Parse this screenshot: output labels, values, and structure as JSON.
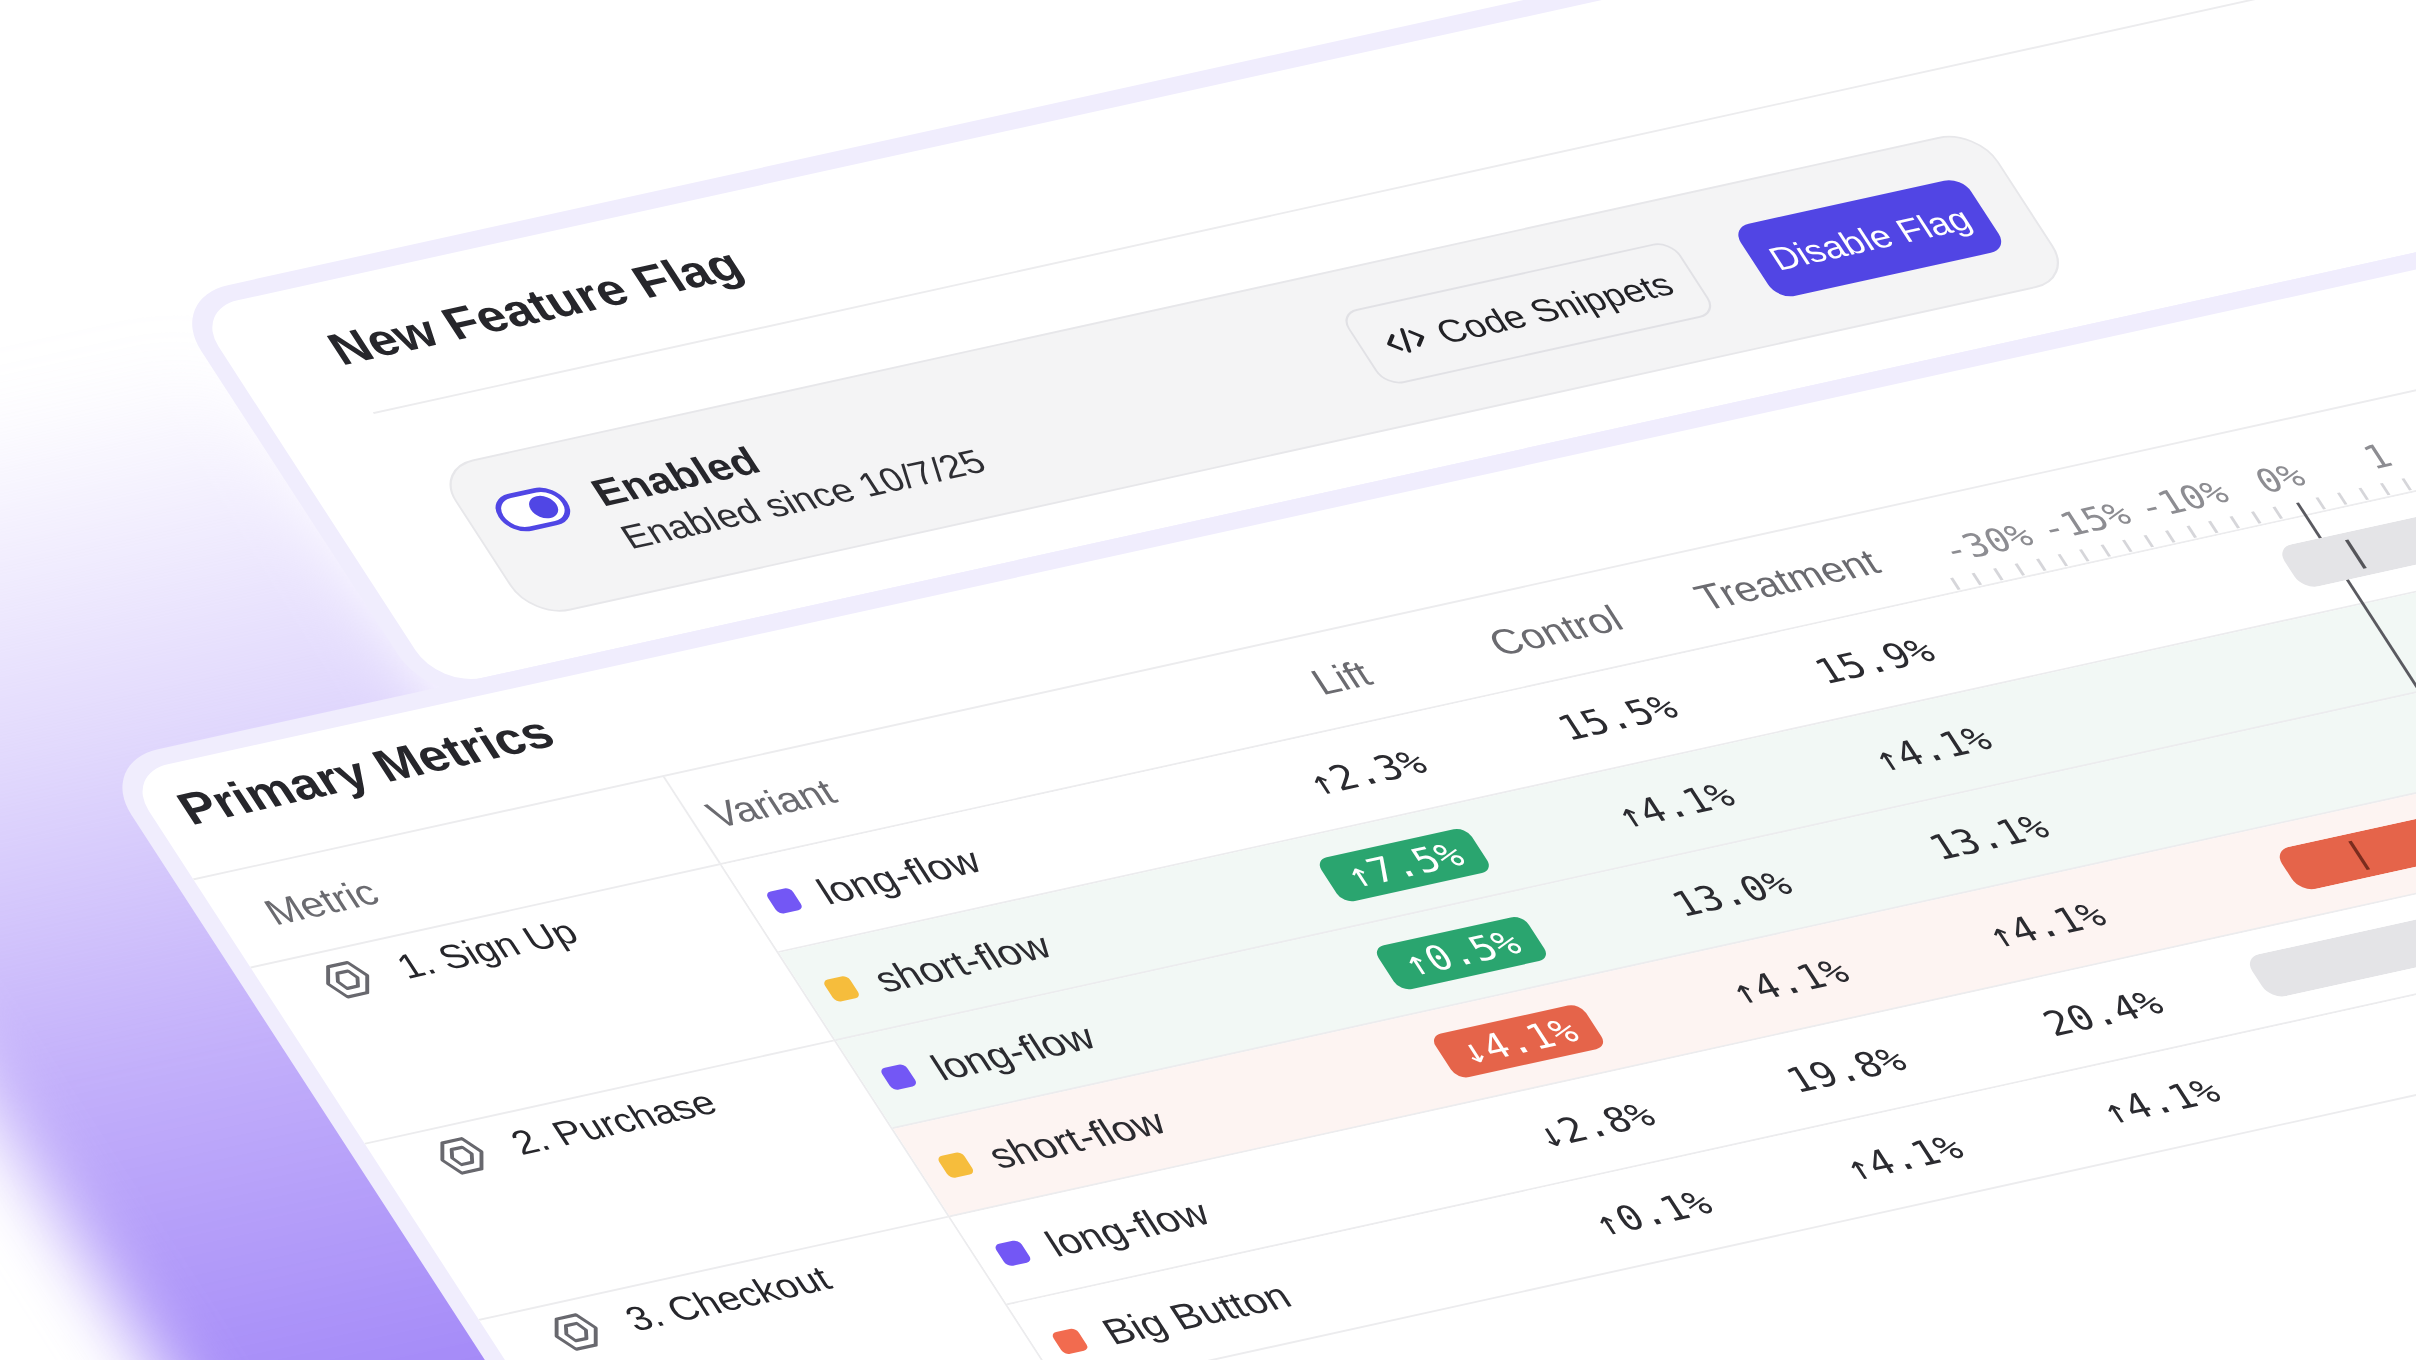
{
  "feature_flag": {
    "title": "New Feature Flag",
    "status": {
      "enabled": true,
      "label": "Enabled",
      "detail": "Enabled since 10/7/25"
    },
    "buttons": [
      {
        "kind": "code",
        "label": "Code Snippets"
      },
      {
        "kind": "primary",
        "label": "Disable Flag"
      }
    ]
  },
  "primary_metrics": {
    "title": "Primary Metrics",
    "columns": [
      "Metric",
      "Variant",
      "Lift",
      "Control",
      "Treatment"
    ],
    "axis_labels": [
      "-30%",
      "-15%",
      "-10%",
      "0%",
      "1"
    ],
    "metrics": [
      {
        "name": "1. Sign Up",
        "variants": [
          {
            "kind": "neutral",
            "name": "long-flow",
            "color": "#7357f5",
            "lift": "↑2.3%",
            "control": "15.5%",
            "treatment": "15.9%"
          },
          {
            "kind": "positive",
            "name": "short-flow",
            "color": "#f6bd3c",
            "lift": "↑7.5%",
            "control": "↑4.1%",
            "treatment": "↑4.1%"
          }
        ]
      },
      {
        "name": "2. Purchase",
        "variants": [
          {
            "kind": "positive",
            "name": "long-flow",
            "color": "#7357f5",
            "lift": "↑0.5%",
            "control": "13.0%",
            "treatment": "13.1%"
          },
          {
            "kind": "negative",
            "name": "short-flow",
            "color": "#f6bd3c",
            "lift": "↓4.1%",
            "control": "↑4.1%",
            "treatment": "↑4.1%"
          }
        ]
      },
      {
        "name": "3. Checkout",
        "variants": [
          {
            "kind": "neutral",
            "name": "long-flow",
            "color": "#7357f5",
            "lift": "↓2.8%",
            "control": "19.8%",
            "treatment": "20.4%"
          },
          {
            "kind": "neutral",
            "name": "Big Button",
            "color": "#f26b4f",
            "lift": "↑0.1%",
            "control": "↑4.1%",
            "treatment": "↑4.1%"
          }
        ]
      }
    ]
  }
}
